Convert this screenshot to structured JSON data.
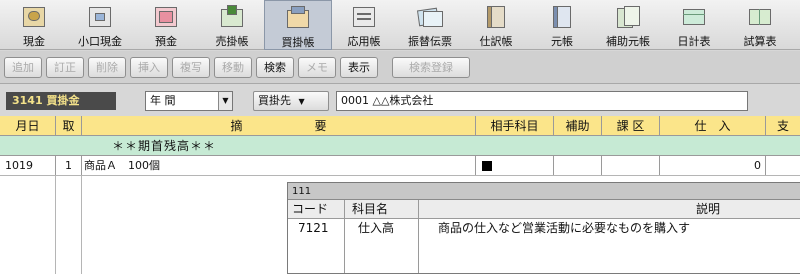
{
  "toolbar": {
    "buttons": [
      {
        "label": "現金",
        "icon": "cash-book-icon"
      },
      {
        "label": "小口現金",
        "icon": "petty-cash-book-icon"
      },
      {
        "label": "預金",
        "icon": "deposit-book-icon"
      },
      {
        "label": "売掛帳",
        "icon": "receivables-book-icon"
      },
      {
        "label": "買掛帳",
        "icon": "payables-book-icon",
        "active": true
      },
      {
        "label": "応用帳",
        "icon": "applied-book-icon"
      },
      {
        "label": "振替伝票",
        "icon": "transfer-slip-icon"
      },
      {
        "label": "仕訳帳",
        "icon": "journal-icon"
      },
      {
        "label": "元帳",
        "icon": "ledger-icon"
      },
      {
        "label": "補助元帳",
        "icon": "sub-ledger-icon"
      },
      {
        "label": "日計表",
        "icon": "daily-report-icon"
      },
      {
        "label": "試算表",
        "icon": "trial-balance-icon"
      }
    ]
  },
  "actions": {
    "add": "追加",
    "correct": "訂正",
    "delete": "削除",
    "insert": "挿入",
    "copy": "複写",
    "move": "移動",
    "search": "検索",
    "memo": "メモ",
    "display": "表示",
    "search_register": "検索登録"
  },
  "filter": {
    "account": "3141 買掛金",
    "period": "年 間",
    "vendor_label": "買掛先",
    "vendor_value": "0001 △△株式会社"
  },
  "grid": {
    "headers": {
      "date": "月日",
      "sub": "取",
      "description": "摘　　　　　　要",
      "counter_account": "相手科目",
      "aux": "補助",
      "tax": "課 区",
      "purchase": "仕　入",
      "pay": "支"
    },
    "opening_row": "＊＊期首残高＊＊",
    "rows": [
      {
        "date": "1019",
        "sub": "1",
        "description": "商品Ａ　100個",
        "purchase": "0"
      }
    ]
  },
  "popup": {
    "title": "111",
    "col_code": "コード",
    "col_name": "科目名",
    "col_desc": "説明",
    "items": [
      {
        "code": "7121",
        "name": "仕入高",
        "desc": "商品の仕入など営業活動に必要なものを購入す"
      }
    ]
  },
  "colors": {
    "header_yellow": "#fbe58a",
    "opening_green": "#c6ead4",
    "account_badge_bg": "#4a4a4a",
    "account_badge_text": "#f4e28a"
  }
}
